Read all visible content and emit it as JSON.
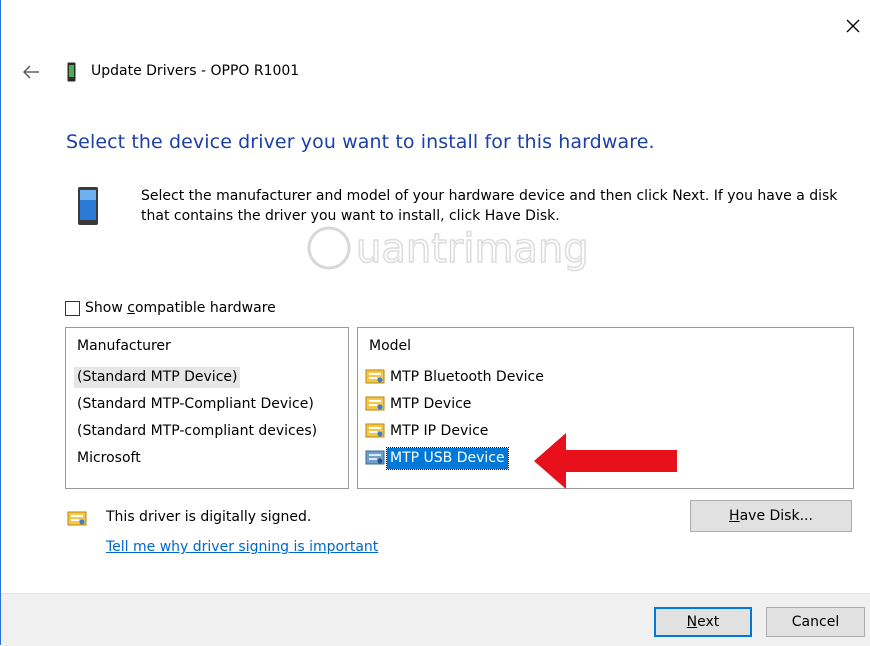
{
  "window": {
    "title": "Update Drivers - OPPO R1001",
    "close_glyph": "✕",
    "back_glyph": "←"
  },
  "heading": "Select the device driver you want to install for this hardware.",
  "description": "Select the manufacturer and model of your hardware device and then click Next. If you have a disk that contains the driver you want to install, click Have Disk.",
  "compatible": {
    "label_pre": "Show ",
    "label_accel": "c",
    "label_post": "ompatible hardware",
    "checked": false
  },
  "manufacturer_list": {
    "header": "Manufacturer",
    "items": [
      {
        "label": "(Standard MTP Device)",
        "selected": true
      },
      {
        "label": "(Standard MTP-Compliant Device)",
        "selected": false
      },
      {
        "label": "(Standard MTP-compliant devices)",
        "selected": false
      },
      {
        "label": "Microsoft",
        "selected": false
      }
    ]
  },
  "model_list": {
    "header": "Model",
    "items": [
      {
        "label": "MTP Bluetooth Device",
        "selected": false
      },
      {
        "label": "MTP Device",
        "selected": false
      },
      {
        "label": "MTP IP Device",
        "selected": false
      },
      {
        "label": "MTP USB Device",
        "selected": true
      }
    ]
  },
  "signed": {
    "text": "This driver is digitally signed.",
    "link": "Tell me why driver signing is important"
  },
  "buttons": {
    "have_disk_accel": "H",
    "have_disk_rest": "ave Disk...",
    "next_accel": "N",
    "next_rest": "ext",
    "cancel": "Cancel"
  },
  "colors": {
    "heading": "#1c3fa8",
    "selection": "#0078d7",
    "arrow": "#e8101a",
    "link": "#0066cc"
  },
  "icons": [
    "close-icon",
    "back-arrow-icon",
    "phone-icon",
    "driver-certificate-icon",
    "red-arrow-annotation"
  ],
  "watermark": "Quantrimang"
}
